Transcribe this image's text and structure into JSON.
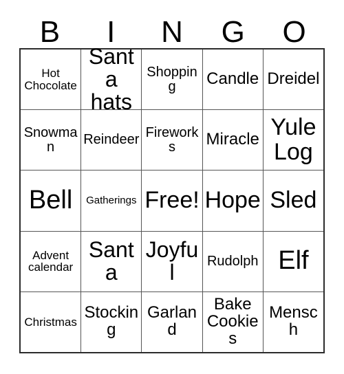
{
  "card": {
    "title": "BINGO",
    "headers": [
      "B",
      "I",
      "N",
      "G",
      "O"
    ],
    "free_space_label": "Free!",
    "grid": {
      "columns": 5,
      "rows": 5,
      "cells": [
        [
          {
            "label": "Hot Chocolate",
            "size": "fs-sm"
          },
          {
            "label": "Santa hats",
            "size": "fs-2xl"
          },
          {
            "label": "Shopping",
            "size": "fs-md"
          },
          {
            "label": "Candle",
            "size": "fs-lg"
          },
          {
            "label": "Dreidel",
            "size": "fs-lg"
          }
        ],
        [
          {
            "label": "Snowman",
            "size": "fs-md"
          },
          {
            "label": "Reindeer",
            "size": "fs-md"
          },
          {
            "label": "Fireworks",
            "size": "fs-md"
          },
          {
            "label": "Miracle",
            "size": "fs-lg"
          },
          {
            "label": "Yule Log",
            "size": "fs-3xl"
          }
        ],
        [
          {
            "label": "Bell",
            "size": "fs-4xl"
          },
          {
            "label": "Gatherings",
            "size": "fs-xs"
          },
          {
            "label": "Free!",
            "size": "fs-3xl"
          },
          {
            "label": "Hope",
            "size": "fs-3xl"
          },
          {
            "label": "Sled",
            "size": "fs-3xl"
          }
        ],
        [
          {
            "label": "Advent calendar",
            "size": "fs-sm"
          },
          {
            "label": "Santa",
            "size": "fs-2xl"
          },
          {
            "label": "Joyful",
            "size": "fs-2xl"
          },
          {
            "label": "Rudolph",
            "size": "fs-md"
          },
          {
            "label": "Elf",
            "size": "fs-4xl"
          }
        ],
        [
          {
            "label": "Christmas",
            "size": "fs-sm"
          },
          {
            "label": "Stocking",
            "size": "fs-lg"
          },
          {
            "label": "Garland",
            "size": "fs-lg"
          },
          {
            "label": "Bake Cookies",
            "size": "fs-lg"
          },
          {
            "label": "Mensch",
            "size": "fs-lg"
          }
        ]
      ]
    },
    "colors": {
      "background": "#ffffff",
      "text": "#000000",
      "grid_line": "#555555",
      "outer_border": "#2b2b2b"
    }
  }
}
